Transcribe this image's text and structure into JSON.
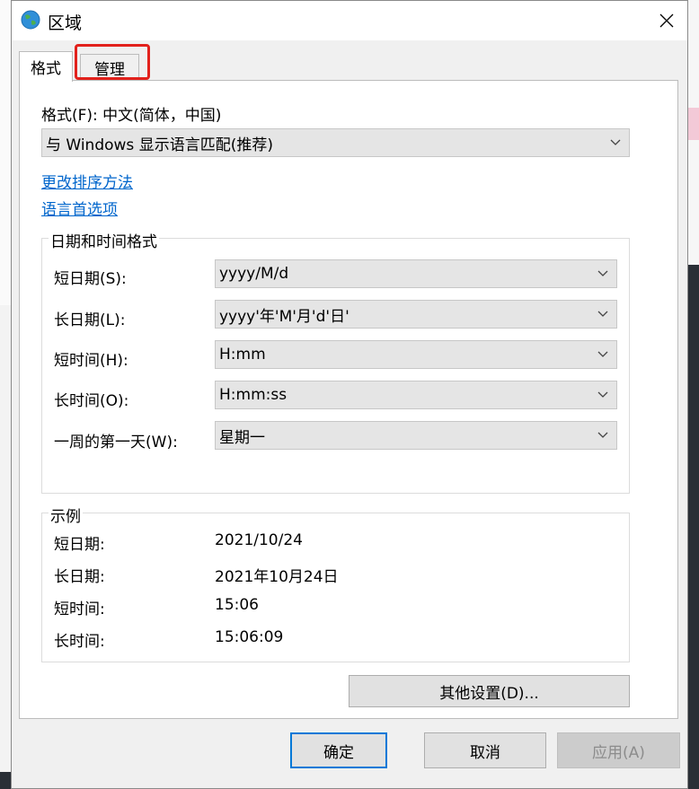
{
  "window": {
    "title": "区域"
  },
  "tabs": [
    {
      "label": "格式",
      "active": true
    },
    {
      "label": "管理",
      "active": false
    }
  ],
  "format": {
    "label": "格式(F): 中文(简体，中国)",
    "selected": "与 Windows 显示语言匹配(推荐)",
    "links": {
      "change_sort": "更改排序方法",
      "language_prefs": "语言首选项"
    }
  },
  "datetime": {
    "title": "日期和时间格式",
    "rows": [
      {
        "label": "短日期(S):",
        "value": "yyyy/M/d"
      },
      {
        "label": "长日期(L):",
        "value": "yyyy'年'M'月'd'日'"
      },
      {
        "label": "短时间(H):",
        "value": "H:mm"
      },
      {
        "label": "长时间(O):",
        "value": "H:mm:ss"
      },
      {
        "label": "一周的第一天(W):",
        "value": "星期一"
      }
    ]
  },
  "examples": {
    "title": "示例",
    "rows": [
      {
        "label": "短日期:",
        "value": "2021/10/24"
      },
      {
        "label": "长日期:",
        "value": "2021年10月24日"
      },
      {
        "label": "短时间:",
        "value": "15:06"
      },
      {
        "label": "长时间:",
        "value": "15:06:09"
      }
    ]
  },
  "buttons": {
    "other_settings": "其他设置(D)...",
    "ok": "确定",
    "cancel": "取消",
    "apply": "应用(A)"
  },
  "colors": {
    "highlight": "#e2211c",
    "link": "#0066cc",
    "primary_border": "#0078d7"
  }
}
